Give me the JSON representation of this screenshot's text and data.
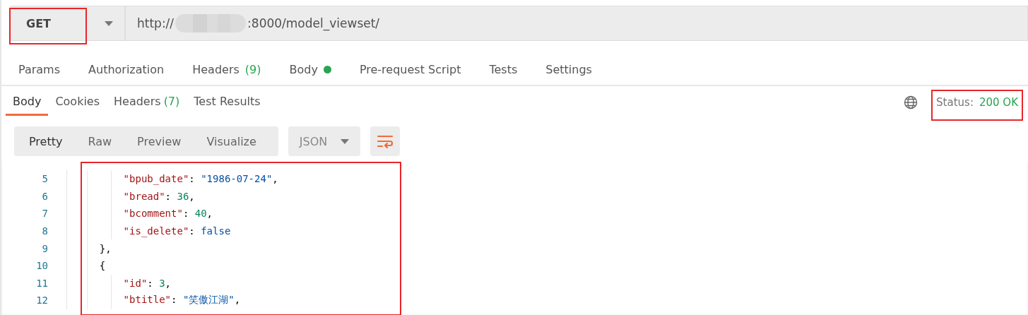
{
  "request": {
    "method": "GET",
    "url_prefix": "http://",
    "url_suffix": ":8000/model_viewset/"
  },
  "request_tabs": [
    {
      "label": "Params",
      "dot": false,
      "selected": false
    },
    {
      "label": "Authorization",
      "dot": false,
      "selected": false
    },
    {
      "label": "Headers",
      "count": "(9)",
      "dot": false,
      "selected": false
    },
    {
      "label": "Body",
      "dot": true,
      "selected": false
    },
    {
      "label": "Pre-request Script",
      "dot": false,
      "selected": false
    },
    {
      "label": "Tests",
      "dot": false,
      "selected": false
    },
    {
      "label": "Settings",
      "dot": false,
      "selected": false
    }
  ],
  "response_tabs": [
    {
      "label": "Body",
      "selected": true
    },
    {
      "label": "Cookies",
      "selected": false
    },
    {
      "label": "Headers",
      "count": "(7)",
      "selected": false
    },
    {
      "label": "Test Results",
      "selected": false
    }
  ],
  "status": {
    "label": "Status:",
    "value": "200 OK"
  },
  "view_modes": [
    {
      "label": "Pretty",
      "selected": true
    },
    {
      "label": "Raw",
      "selected": false
    },
    {
      "label": "Preview",
      "selected": false
    },
    {
      "label": "Visualize",
      "selected": false
    }
  ],
  "format": "JSON",
  "code_lines": [
    {
      "number": "5",
      "kind": "member",
      "tokens": [
        {
          "kind": "key",
          "text": "\"bpub_date\""
        },
        {
          "kind": "punct",
          "text": ": "
        },
        {
          "kind": "string",
          "text": "\"1986-07-24\""
        },
        {
          "kind": "punct",
          "text": ","
        }
      ]
    },
    {
      "number": "6",
      "kind": "member",
      "tokens": [
        {
          "kind": "key",
          "text": "\"bread\""
        },
        {
          "kind": "punct",
          "text": ": "
        },
        {
          "kind": "number",
          "text": "36"
        },
        {
          "kind": "punct",
          "text": ","
        }
      ]
    },
    {
      "number": "7",
      "kind": "member",
      "tokens": [
        {
          "kind": "key",
          "text": "\"bcomment\""
        },
        {
          "kind": "punct",
          "text": ": "
        },
        {
          "kind": "number",
          "text": "40"
        },
        {
          "kind": "punct",
          "text": ","
        }
      ]
    },
    {
      "number": "8",
      "kind": "member",
      "tokens": [
        {
          "kind": "key",
          "text": "\"is_delete\""
        },
        {
          "kind": "punct",
          "text": ": "
        },
        {
          "kind": "bool",
          "text": "false"
        }
      ]
    },
    {
      "number": "9",
      "kind": "brace",
      "tokens": [
        {
          "kind": "punct",
          "text": "},"
        }
      ]
    },
    {
      "number": "10",
      "kind": "brace",
      "tokens": [
        {
          "kind": "punct",
          "text": "{"
        }
      ]
    },
    {
      "number": "11",
      "kind": "member",
      "tokens": [
        {
          "kind": "key",
          "text": "\"id\""
        },
        {
          "kind": "punct",
          "text": ": "
        },
        {
          "kind": "number",
          "text": "3"
        },
        {
          "kind": "punct",
          "text": ","
        }
      ]
    },
    {
      "number": "12",
      "kind": "member",
      "tokens": [
        {
          "kind": "key",
          "text": "\"btitle\""
        },
        {
          "kind": "punct",
          "text": ": "
        },
        {
          "kind": "string",
          "text": "\"笑傲江湖\""
        },
        {
          "kind": "punct",
          "text": ","
        }
      ]
    }
  ]
}
